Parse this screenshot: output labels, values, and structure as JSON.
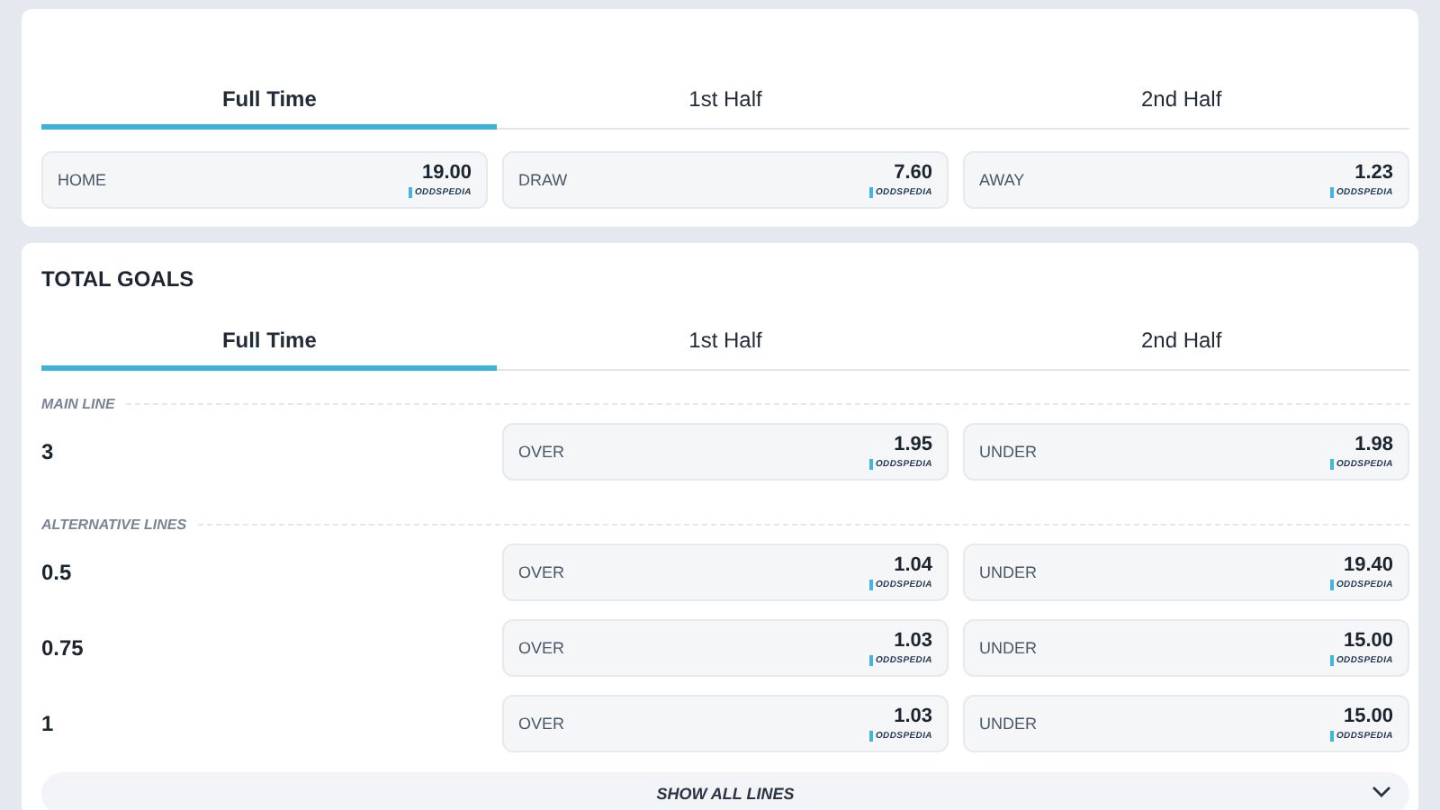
{
  "result_card": {
    "tabs": [
      {
        "label": "Full Time",
        "selected": true
      },
      {
        "label": "1st Half",
        "selected": false
      },
      {
        "label": "2nd Half",
        "selected": false
      }
    ],
    "odds": [
      {
        "label": "HOME",
        "value": "19.00",
        "provider": "ODDSPEDIA"
      },
      {
        "label": "DRAW",
        "value": "7.60",
        "provider": "ODDSPEDIA"
      },
      {
        "label": "AWAY",
        "value": "1.23",
        "provider": "ODDSPEDIA"
      }
    ]
  },
  "total_goals": {
    "title": "TOTAL GOALS",
    "tabs": [
      {
        "label": "Full Time",
        "selected": true
      },
      {
        "label": "1st Half",
        "selected": false
      },
      {
        "label": "2nd Half",
        "selected": false
      }
    ],
    "sections": [
      {
        "heading": "MAIN LINE",
        "lines": [
          {
            "line": "3",
            "odds": [
              {
                "label": "OVER",
                "value": "1.95",
                "provider": "ODDSPEDIA"
              },
              {
                "label": "UNDER",
                "value": "1.98",
                "provider": "ODDSPEDIA"
              }
            ]
          }
        ]
      },
      {
        "heading": "ALTERNATIVE LINES",
        "lines": [
          {
            "line": "0.5",
            "odds": [
              {
                "label": "OVER",
                "value": "1.04",
                "provider": "ODDSPEDIA"
              },
              {
                "label": "UNDER",
                "value": "19.40",
                "provider": "ODDSPEDIA"
              }
            ]
          },
          {
            "line": "0.75",
            "odds": [
              {
                "label": "OVER",
                "value": "1.03",
                "provider": "ODDSPEDIA"
              },
              {
                "label": "UNDER",
                "value": "15.00",
                "provider": "ODDSPEDIA"
              }
            ]
          },
          {
            "line": "1",
            "odds": [
              {
                "label": "OVER",
                "value": "1.03",
                "provider": "ODDSPEDIA"
              },
              {
                "label": "UNDER",
                "value": "15.00",
                "provider": "ODDSPEDIA"
              }
            ]
          }
        ]
      }
    ],
    "show_all": "SHOW ALL LINES"
  }
}
